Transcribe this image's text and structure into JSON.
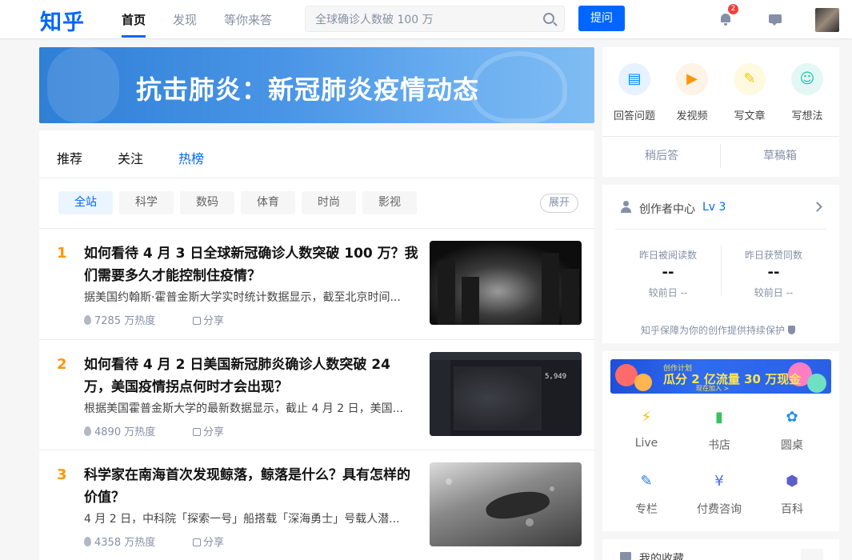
{
  "header": {
    "logo": "知乎",
    "nav": [
      "首页",
      "发现",
      "等你来答"
    ],
    "search_value": "全球确诊人数破 100 万",
    "ask_label": "提问",
    "notification_count": "2",
    "accent": "#0066ff"
  },
  "banner": {
    "title": "抗击肺炎：新冠肺炎疫情动态"
  },
  "tabs": [
    "推荐",
    "关注",
    "热榜"
  ],
  "chips": [
    "全站",
    "科学",
    "数码",
    "体育",
    "时尚",
    "影视"
  ],
  "expand_label": "展开",
  "hot_list": [
    {
      "rank": "1",
      "title": "如何看待 4 月 3 日全球新冠确诊人数突破 100 万？我们需要多久才能控制住疫情？",
      "excerpt": "据美国约翰斯·霍普金斯大学实时统计数据显示，截至北京时间...",
      "heat": "7285 万热度",
      "share": "分享"
    },
    {
      "rank": "2",
      "title": "如何看待 4 月 2 日美国新冠肺炎确诊人数突破 24 万，美国疫情拐点何时才会出现？",
      "excerpt": "根据美国霍普金斯大学的最新数据显示，截止 4 月 2 日，美国...",
      "heat": "4890 万热度",
      "share": "分享",
      "thumb_number": "5,949"
    },
    {
      "rank": "3",
      "title": "科学家在南海首次发现鲸落，鲸落是什么？具有怎样的价值？",
      "excerpt": "4 月 2 日，中科院「探索一号」船搭载「深海勇士」号载人潜...",
      "heat": "4358 万热度",
      "share": "分享"
    }
  ],
  "sidebar": {
    "actions": [
      {
        "label": "回答问题",
        "icon": "answer-icon",
        "color": "#0084ff"
      },
      {
        "label": "发视频",
        "icon": "video-icon",
        "color": "#ff9607"
      },
      {
        "label": "写文章",
        "icon": "write-icon",
        "color": "#f5c400"
      },
      {
        "label": "写想法",
        "icon": "idea-icon",
        "color": "#1ac3b3"
      }
    ],
    "later_label": "稍后答",
    "drafts_label": "草稿箱",
    "creator": {
      "title": "创作者中心",
      "level": "Lv 3",
      "stats": [
        {
          "label": "昨日被阅读数",
          "value": "--",
          "sub": "较前日 --"
        },
        {
          "label": "昨日获赞同数",
          "value": "--",
          "sub": "较前日 --"
        }
      ],
      "protect_text": "知乎保障为你的创作提供持续保护"
    },
    "promo": {
      "small": "创作计划",
      "big": "瓜分 2 亿流量 30 万现金",
      "join": "现在加入 >"
    },
    "services": [
      {
        "label": "Live",
        "icon": "live-icon",
        "color": "#ffb800"
      },
      {
        "label": "书店",
        "icon": "bookstore-icon",
        "color": "#37c35b"
      },
      {
        "label": "圆桌",
        "icon": "roundtable-icon",
        "color": "#1e8ff0"
      },
      {
        "label": "专栏",
        "icon": "column-icon",
        "color": "#1f7cf0"
      },
      {
        "label": "付费咨询",
        "icon": "consult-icon",
        "color": "#4d6ef5"
      },
      {
        "label": "百科",
        "icon": "encyclopedia-icon",
        "color": "#5b5fc7"
      }
    ],
    "favorites_label": "我的收藏"
  }
}
